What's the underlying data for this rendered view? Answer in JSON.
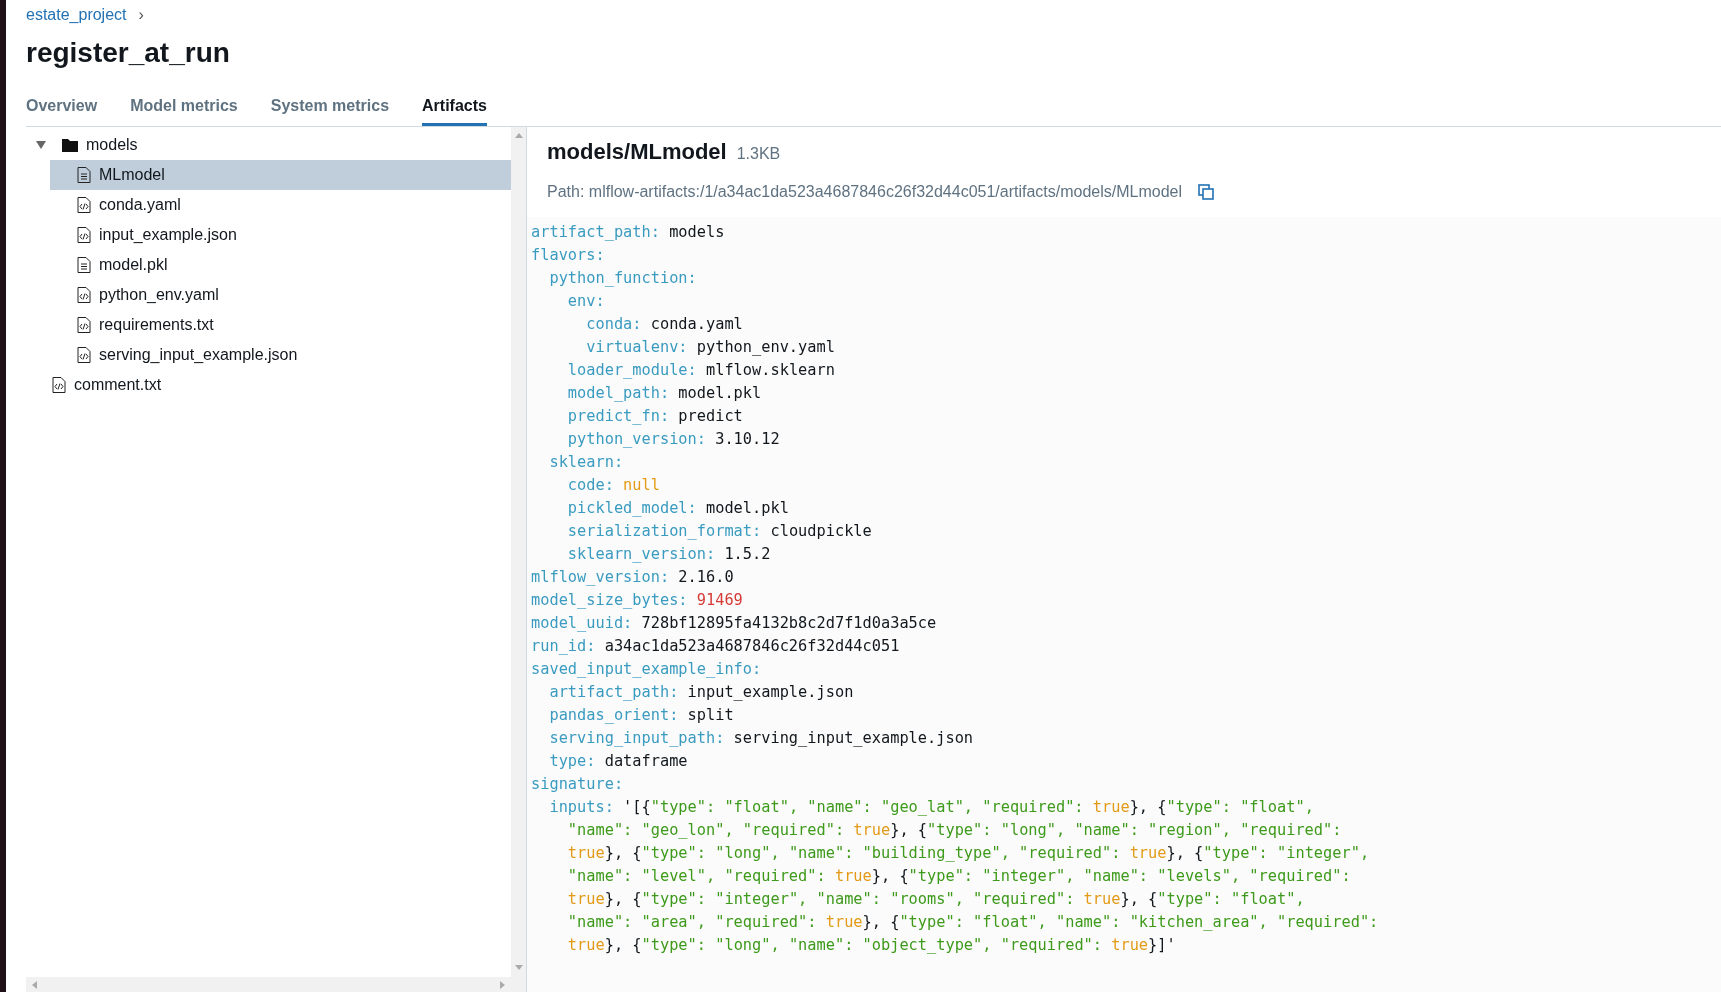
{
  "breadcrumb": {
    "project": "estate_project",
    "separator": "›"
  },
  "title": "register_at_run",
  "tabs": [
    {
      "label": "Overview",
      "selected": false
    },
    {
      "label": "Model metrics",
      "selected": false
    },
    {
      "label": "System metrics",
      "selected": false
    },
    {
      "label": "Artifacts",
      "selected": true
    }
  ],
  "tree": [
    {
      "name": "models",
      "kind": "folder",
      "expanded": true,
      "selected": false,
      "children": [
        {
          "name": "MLmodel",
          "kind": "text",
          "selected": true
        },
        {
          "name": "conda.yaml",
          "kind": "code",
          "selected": false
        },
        {
          "name": "input_example.json",
          "kind": "code",
          "selected": false
        },
        {
          "name": "model.pkl",
          "kind": "text",
          "selected": false
        },
        {
          "name": "python_env.yaml",
          "kind": "code",
          "selected": false
        },
        {
          "name": "requirements.txt",
          "kind": "code",
          "selected": false
        },
        {
          "name": "serving_input_example.json",
          "kind": "code",
          "selected": false
        }
      ]
    },
    {
      "name": "comment.txt",
      "kind": "code",
      "selected": false
    }
  ],
  "file": {
    "name": "models/MLmodel",
    "size": "1.3KB",
    "path": "Path: mlflow-artifacts:/1/a34ac1da523a4687846c26f32d44c051/artifacts/models/MLmodel"
  },
  "code_lines": [
    [
      {
        "kind": "key",
        "text": "artifact_path:"
      },
      {
        "kind": "plain",
        "text": " models"
      }
    ],
    [
      {
        "kind": "key",
        "text": "flavors:"
      }
    ],
    [
      {
        "kind": "key",
        "text": "  python_function:"
      }
    ],
    [
      {
        "kind": "key",
        "text": "    env:"
      }
    ],
    [
      {
        "kind": "key",
        "text": "      conda:"
      },
      {
        "kind": "plain",
        "text": " conda.yaml"
      }
    ],
    [
      {
        "kind": "key",
        "text": "      virtualenv:"
      },
      {
        "kind": "plain",
        "text": " python_env.yaml"
      }
    ],
    [
      {
        "kind": "key",
        "text": "    loader_module:"
      },
      {
        "kind": "plain",
        "text": " mlflow.sklearn"
      }
    ],
    [
      {
        "kind": "key",
        "text": "    model_path:"
      },
      {
        "kind": "plain",
        "text": " model.pkl"
      }
    ],
    [
      {
        "kind": "key",
        "text": "    predict_fn:"
      },
      {
        "kind": "plain",
        "text": " predict"
      }
    ],
    [
      {
        "kind": "key",
        "text": "    python_version:"
      },
      {
        "kind": "plain",
        "text": " 3.10.12"
      }
    ],
    [
      {
        "kind": "key",
        "text": "  sklearn:"
      }
    ],
    [
      {
        "kind": "key",
        "text": "    code:"
      },
      {
        "kind": "literal",
        "text": " null"
      }
    ],
    [
      {
        "kind": "key",
        "text": "    pickled_model:"
      },
      {
        "kind": "plain",
        "text": " model.pkl"
      }
    ],
    [
      {
        "kind": "key",
        "text": "    serialization_format:"
      },
      {
        "kind": "plain",
        "text": " cloudpickle"
      }
    ],
    [
      {
        "kind": "key",
        "text": "    sklearn_version:"
      },
      {
        "kind": "plain",
        "text": " 1.5.2"
      }
    ],
    [
      {
        "kind": "key",
        "text": "mlflow_version:"
      },
      {
        "kind": "plain",
        "text": " 2.16.0"
      }
    ],
    [
      {
        "kind": "key",
        "text": "model_size_bytes:"
      },
      {
        "kind": "number",
        "text": " 91469"
      }
    ],
    [
      {
        "kind": "key",
        "text": "model_uuid:"
      },
      {
        "kind": "plain",
        "text": " 728bf12895fa4132b8c2d7f1d0a3a5ce"
      }
    ],
    [
      {
        "kind": "key",
        "text": "run_id:"
      },
      {
        "kind": "plain",
        "text": " a34ac1da523a4687846c26f32d44c051"
      }
    ],
    [
      {
        "kind": "key",
        "text": "saved_input_example_info:"
      }
    ],
    [
      {
        "kind": "key",
        "text": "  artifact_path:"
      },
      {
        "kind": "plain",
        "text": " input_example.json"
      }
    ],
    [
      {
        "kind": "key",
        "text": "  pandas_orient:"
      },
      {
        "kind": "plain",
        "text": " split"
      }
    ],
    [
      {
        "kind": "key",
        "text": "  serving_input_path:"
      },
      {
        "kind": "plain",
        "text": " serving_input_example.json"
      }
    ],
    [
      {
        "kind": "key",
        "text": "  type:"
      },
      {
        "kind": "plain",
        "text": " dataframe"
      }
    ],
    [
      {
        "kind": "key",
        "text": "signature:"
      }
    ],
    [
      {
        "kind": "key",
        "text": "  inputs:"
      },
      {
        "kind": "plain",
        "text": " '[{"
      },
      {
        "kind": "string",
        "text": "\"type\": \"float\", \"name\": \"geo_lat\", \"required\": "
      },
      {
        "kind": "literal",
        "text": "true"
      },
      {
        "kind": "plain",
        "text": "}, {"
      },
      {
        "kind": "string",
        "text": "\"type\": \"float\","
      }
    ],
    [
      {
        "kind": "string",
        "text": "    \"name\": \"geo_lon\", \"required\": "
      },
      {
        "kind": "literal",
        "text": "true"
      },
      {
        "kind": "plain",
        "text": "}, {"
      },
      {
        "kind": "string",
        "text": "\"type\": \"long\", \"name\": \"region\", \"required\":"
      }
    ],
    [
      {
        "kind": "literal",
        "text": "    true"
      },
      {
        "kind": "plain",
        "text": "}, {"
      },
      {
        "kind": "string",
        "text": "\"type\": \"long\", \"name\": \"building_type\", \"required\": "
      },
      {
        "kind": "literal",
        "text": "true"
      },
      {
        "kind": "plain",
        "text": "}, {"
      },
      {
        "kind": "string",
        "text": "\"type\": \"integer\","
      }
    ],
    [
      {
        "kind": "string",
        "text": "    \"name\": \"level\", \"required\": "
      },
      {
        "kind": "literal",
        "text": "true"
      },
      {
        "kind": "plain",
        "text": "}, {"
      },
      {
        "kind": "string",
        "text": "\"type\": \"integer\", \"name\": \"levels\", \"required\":"
      }
    ],
    [
      {
        "kind": "literal",
        "text": "    true"
      },
      {
        "kind": "plain",
        "text": "}, {"
      },
      {
        "kind": "string",
        "text": "\"type\": \"integer\", \"name\": \"rooms\", \"required\": "
      },
      {
        "kind": "literal",
        "text": "true"
      },
      {
        "kind": "plain",
        "text": "}, {"
      },
      {
        "kind": "string",
        "text": "\"type\": \"float\","
      }
    ],
    [
      {
        "kind": "string",
        "text": "    \"name\": \"area\", \"required\": "
      },
      {
        "kind": "literal",
        "text": "true"
      },
      {
        "kind": "plain",
        "text": "}, {"
      },
      {
        "kind": "string",
        "text": "\"type\": \"float\", \"name\": \"kitchen_area\", \"required\":"
      }
    ],
    [
      {
        "kind": "literal",
        "text": "    true"
      },
      {
        "kind": "plain",
        "text": "}, {"
      },
      {
        "kind": "string",
        "text": "\"type\": \"long\", \"name\": \"object_type\", \"required\": "
      },
      {
        "kind": "literal",
        "text": "true"
      },
      {
        "kind": "plain",
        "text": "}]'"
      }
    ]
  ]
}
